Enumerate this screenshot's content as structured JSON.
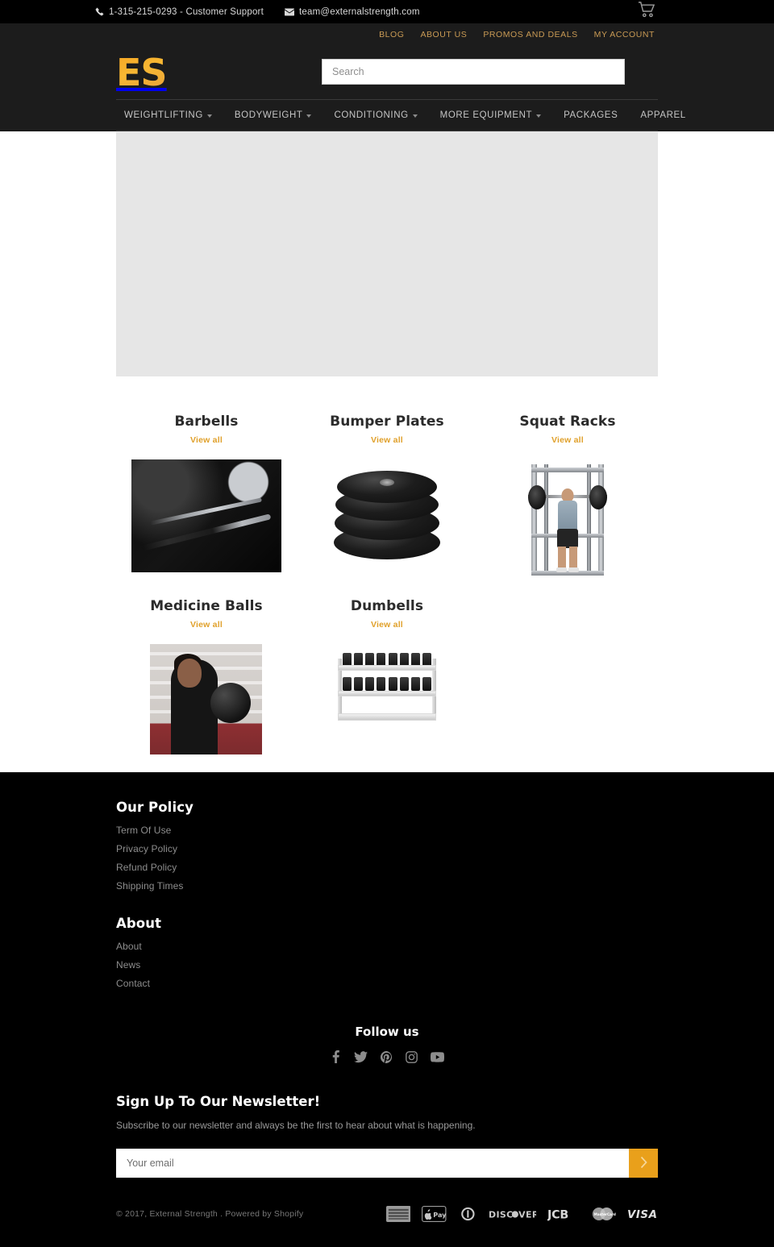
{
  "topbar": {
    "phone": "1-315-215-0293  - Customer Support",
    "phone_icon": "phone-icon",
    "email": "team@externalstrength.com",
    "email_icon": "envelope-icon"
  },
  "utility_nav": [
    {
      "label": "BLOG"
    },
    {
      "label": "ABOUT US"
    },
    {
      "label": "PROMOS AND DEALS"
    },
    {
      "label": "MY ACCOUNT"
    }
  ],
  "header": {
    "logo_text": "ES",
    "cart_icon": "shopping-cart-icon"
  },
  "search": {
    "value": "",
    "placeholder": "Search"
  },
  "main_nav": [
    {
      "label": "WEIGHTLIFTING",
      "has_dropdown": true
    },
    {
      "label": "BODYWEIGHT",
      "has_dropdown": true
    },
    {
      "label": "CONDITIONING",
      "has_dropdown": true
    },
    {
      "label": "MORE EQUIPMENT",
      "has_dropdown": true
    },
    {
      "label": "PACKAGES",
      "has_dropdown": false
    },
    {
      "label": "APPAREL",
      "has_dropdown": false
    }
  ],
  "collections": {
    "view_all_label": "View all",
    "items": [
      {
        "title": "Barbells",
        "image": "barbell-photo"
      },
      {
        "title": "Bumper Plates",
        "image": "bumper-plates-photo"
      },
      {
        "title": "Squat Racks",
        "image": "squat-rack-photo"
      },
      {
        "title": "Medicine Balls",
        "image": "medicine-ball-photo"
      },
      {
        "title": "Dumbells",
        "image": "dumbbell-rack-photo"
      }
    ]
  },
  "footer": {
    "policy": {
      "heading": "Our Policy",
      "links": [
        {
          "label": "Term Of Use"
        },
        {
          "label": "Privacy Policy"
        },
        {
          "label": "Refund Policy"
        },
        {
          "label": "Shipping Times"
        }
      ]
    },
    "about": {
      "heading": "About",
      "links": [
        {
          "label": "About"
        },
        {
          "label": "News"
        },
        {
          "label": "Contact"
        }
      ]
    },
    "follow": {
      "heading": "Follow us",
      "socials": [
        {
          "name": "facebook-icon"
        },
        {
          "name": "twitter-icon"
        },
        {
          "name": "pinterest-icon"
        },
        {
          "name": "instagram-icon"
        },
        {
          "name": "youtube-icon"
        }
      ]
    },
    "newsletter": {
      "heading": "Sign Up To Our Newsletter!",
      "subtext": "Subscribe to our newsletter and always be the first to hear about what is happening.",
      "input_value": "",
      "input_placeholder": "Your email",
      "submit_icon": "chevron-right-icon"
    },
    "copyright": "© 2017, External Strength . Powered by Shopify",
    "payment_methods": [
      {
        "name": "american-express-icon",
        "label": "AMERICAN EXPRESS"
      },
      {
        "name": "apple-pay-icon",
        "label": "Pay"
      },
      {
        "name": "diners-club-icon",
        "label": "Diners Club"
      },
      {
        "name": "discover-icon",
        "label": "DISCOVER"
      },
      {
        "name": "jcb-icon",
        "label": "JCB"
      },
      {
        "name": "mastercard-icon",
        "label": "MasterCard"
      },
      {
        "name": "visa-icon",
        "label": "VISA"
      }
    ]
  },
  "colors": {
    "brand_orange": "#e9a01b",
    "accent_gold": "#c99a54",
    "view_all": "#e0a02a",
    "header_bg": "#1c1c1c",
    "page_bg": "#000000",
    "slider_placeholder": "#e6e6e6"
  }
}
